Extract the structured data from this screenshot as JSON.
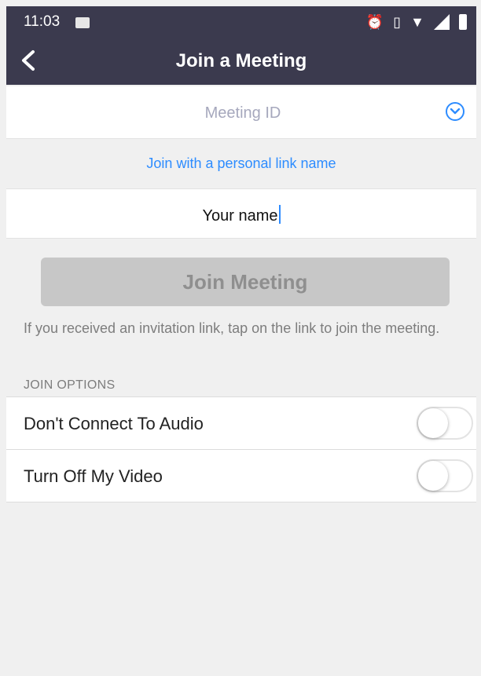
{
  "status_bar": {
    "time": "11:03",
    "icons": [
      "notification-icon",
      "alarm-icon",
      "vibrate-icon",
      "wifi-icon",
      "signal-icon",
      "battery-icon"
    ]
  },
  "header": {
    "title": "Join a Meeting",
    "back_icon": "back-arrow-icon",
    "background": "#3b3a4e"
  },
  "meeting_id": {
    "placeholder": "Meeting ID",
    "value": "",
    "dropdown_icon": "chevron-down-circle-icon"
  },
  "personal_link": {
    "label": "Join with a personal link name"
  },
  "name_field": {
    "value": "Your name"
  },
  "join_button": {
    "label": "Join Meeting",
    "enabled": false
  },
  "hint": "If you received an invitation link, tap on the link to join the meeting.",
  "join_options": {
    "title": "JOIN OPTIONS",
    "options": [
      {
        "label": "Don't Connect To Audio",
        "on": false
      },
      {
        "label": "Turn Off My Video",
        "on": false
      }
    ]
  },
  "colors": {
    "accent": "#2d8cff",
    "header": "#3b3a4e",
    "disabled_button": "#c7c7c7"
  }
}
